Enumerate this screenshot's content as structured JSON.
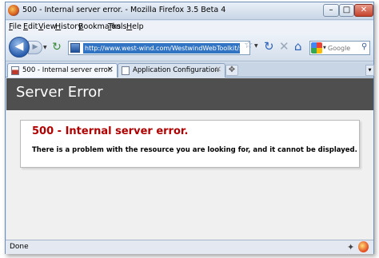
{
  "window": {
    "title": "500 - Internal server error. - Mozilla Firefox 3.5 Beta 4",
    "controls": {
      "minimize": "–",
      "maximize": "□",
      "close": "✕"
    }
  },
  "menu": [
    "File",
    "Edit",
    "View",
    "History",
    "Bookmarks",
    "Tools",
    "Help"
  ],
  "navbar": {
    "url": "http://www.west-wind.com/WestwindWebToolkit/samples/testpage.",
    "search_placeholder": "Google"
  },
  "tabs": [
    {
      "label": "500 - Internal server error.",
      "active": true
    },
    {
      "label": "Application Configuration",
      "active": false
    }
  ],
  "page": {
    "heading": "Server Error",
    "error_title": "500 - Internal server error.",
    "error_message": "There is a problem with the resource you are looking for, and it cannot be displayed."
  },
  "status": {
    "text": "Done"
  },
  "colors": {
    "banner": "#4f4f4f",
    "error_title": "#b10000",
    "url_highlight": "#3174c4"
  }
}
